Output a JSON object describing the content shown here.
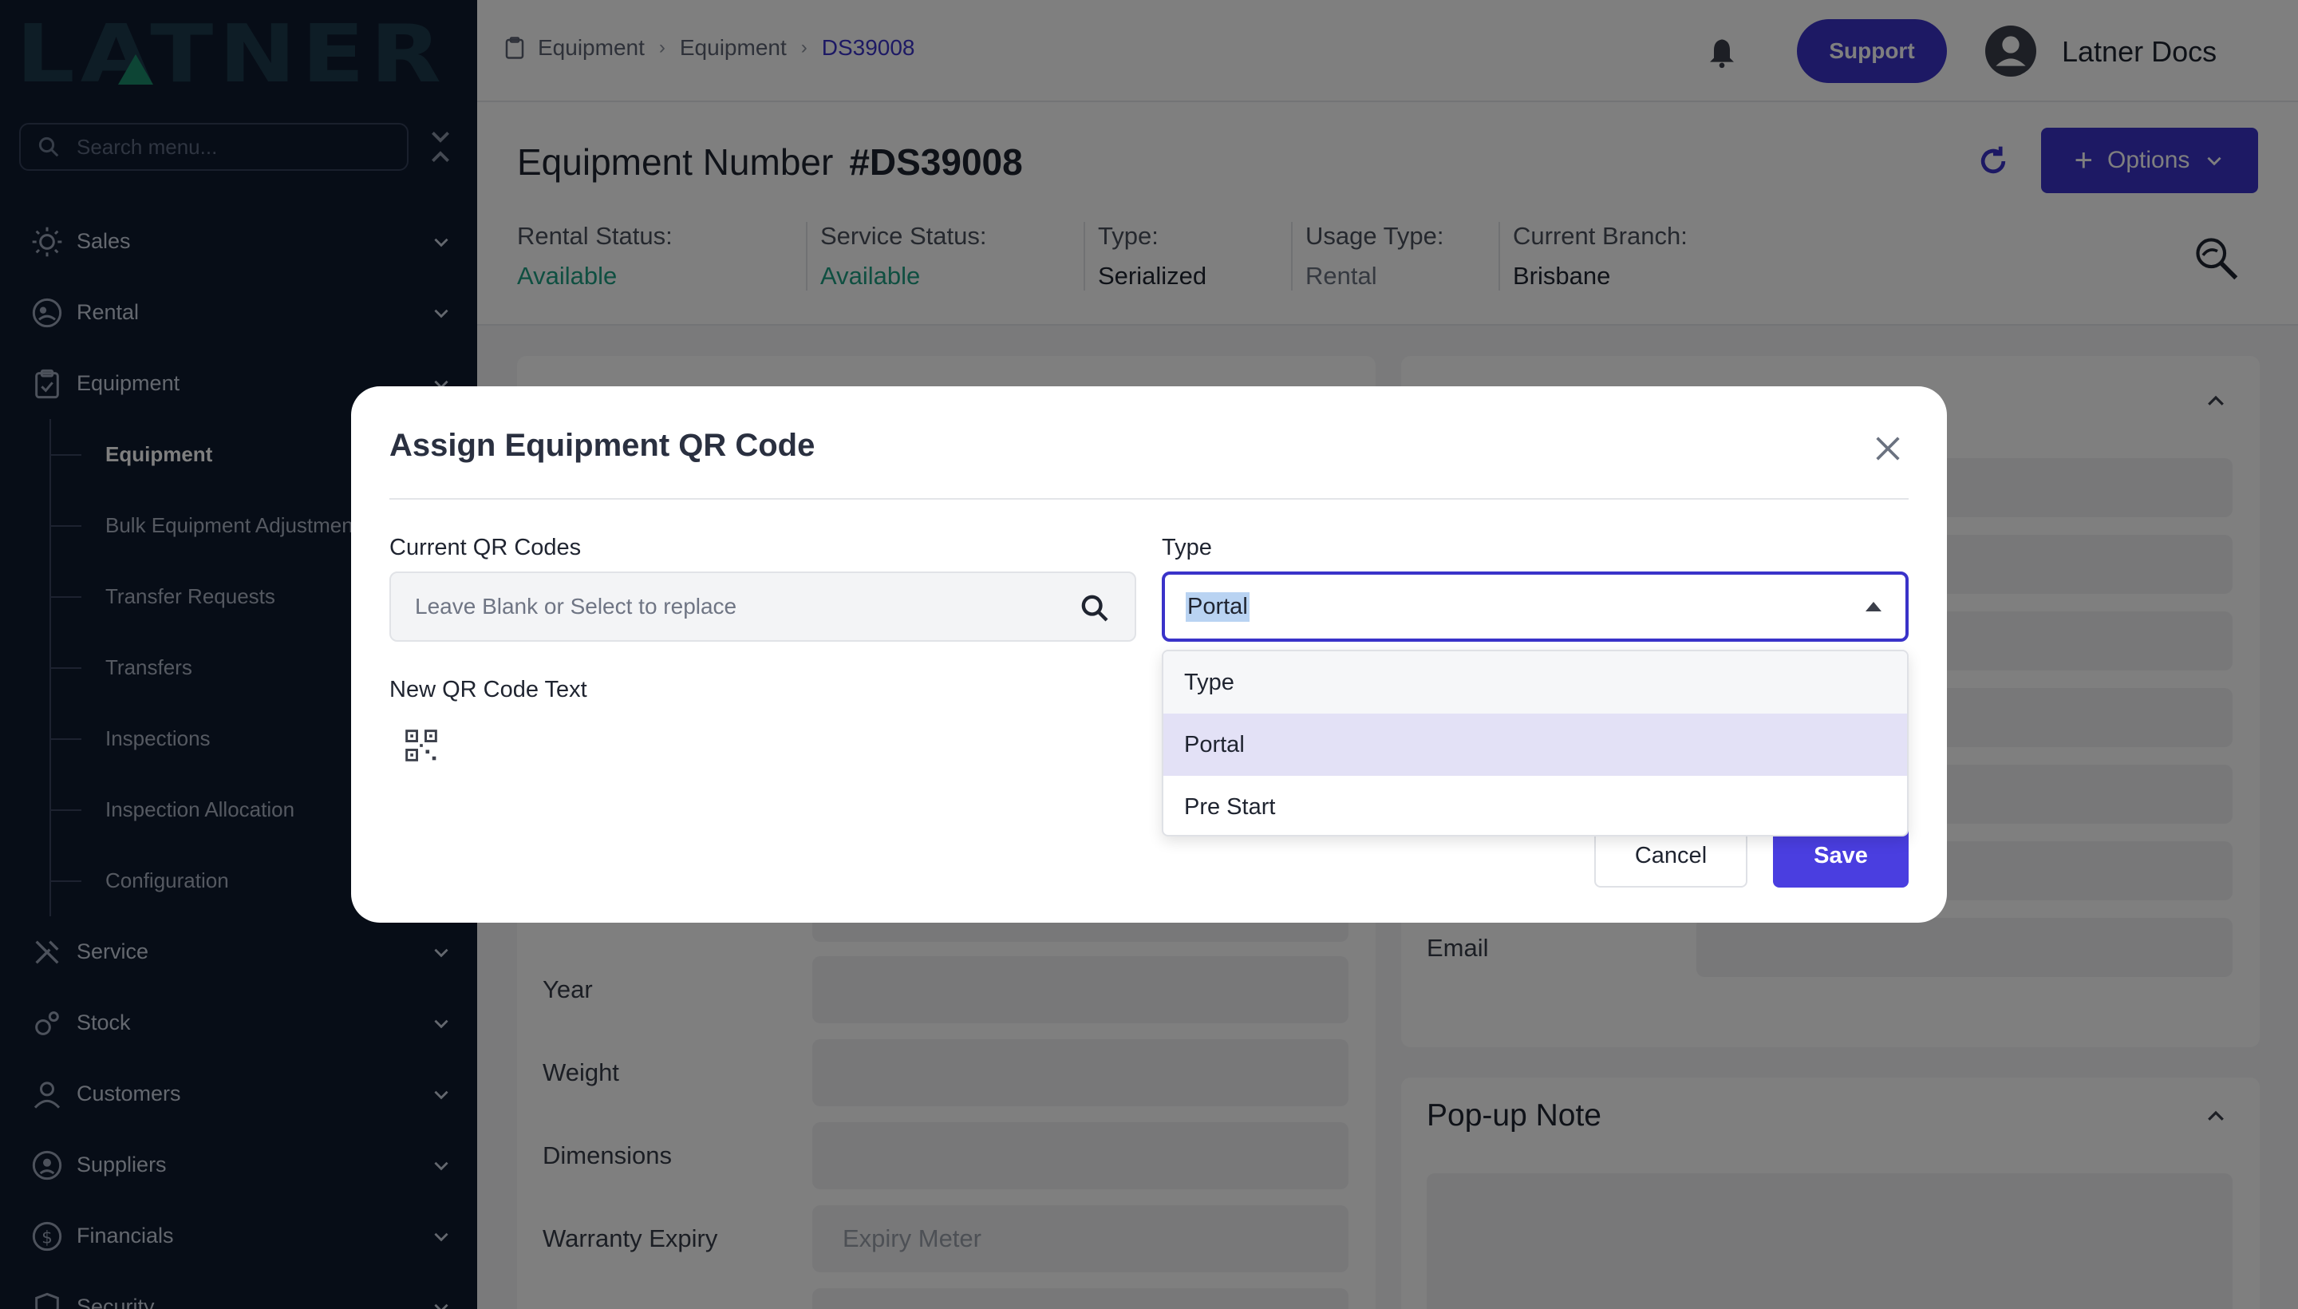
{
  "logo": {
    "text": "LATNER"
  },
  "sidebar": {
    "search_placeholder": "Search menu...",
    "items": [
      {
        "label": "Sales",
        "icon": "sales-icon"
      },
      {
        "label": "Rental",
        "icon": "rental-icon"
      },
      {
        "label": "Equipment",
        "icon": "equipment-icon"
      },
      {
        "label": "Service",
        "icon": "service-icon"
      },
      {
        "label": "Stock",
        "icon": "stock-icon"
      },
      {
        "label": "Customers",
        "icon": "customers-icon"
      },
      {
        "label": "Suppliers",
        "icon": "suppliers-icon"
      },
      {
        "label": "Financials",
        "icon": "financials-icon"
      },
      {
        "label": "Security",
        "icon": "security-icon"
      }
    ],
    "equipment_sub": [
      "Equipment",
      "Bulk Equipment Adjustmen",
      "Transfer Requests",
      "Transfers",
      "Inspections",
      "Inspection Allocation",
      "Configuration"
    ]
  },
  "header": {
    "breadcrumb": [
      "Equipment",
      "Equipment",
      "DS39008"
    ],
    "support_label": "Support",
    "user_name": "Latner Docs"
  },
  "page": {
    "title_prefix": "Equipment Number",
    "title_number": "#DS39008",
    "options_label": "Options",
    "stats": [
      {
        "label": "Rental Status:",
        "value": "Available"
      },
      {
        "label": "Service Status:",
        "value": "Available"
      },
      {
        "label": "Type:",
        "value": "Serialized"
      },
      {
        "label": "Usage Type:",
        "value": "Rental"
      },
      {
        "label": "Current Branch:",
        "value": "Brisbane"
      }
    ],
    "fields": [
      "Year",
      "Weight",
      "Dimensions",
      "Warranty Expiry"
    ],
    "warranty_placeholder": "Expiry Meter",
    "email_label": "Email",
    "popup_note_title": "Pop-up Note"
  },
  "modal": {
    "title": "Assign Equipment QR Code",
    "current_qr_label": "Current QR Codes",
    "current_qr_placeholder": "Leave Blank or Select to replace",
    "new_qr_label": "New QR Code Text",
    "type_label": "Type",
    "type_value": "Portal",
    "type_options": [
      "Type",
      "Portal",
      "Pre Start"
    ],
    "cancel_label": "Cancel",
    "save_label": "Save"
  },
  "colors": {
    "brand": "#3a33c9",
    "sidebar_bg": "#0f1a2e",
    "status_green": "#1f9e82",
    "logo_green": "#1b8a6b"
  }
}
